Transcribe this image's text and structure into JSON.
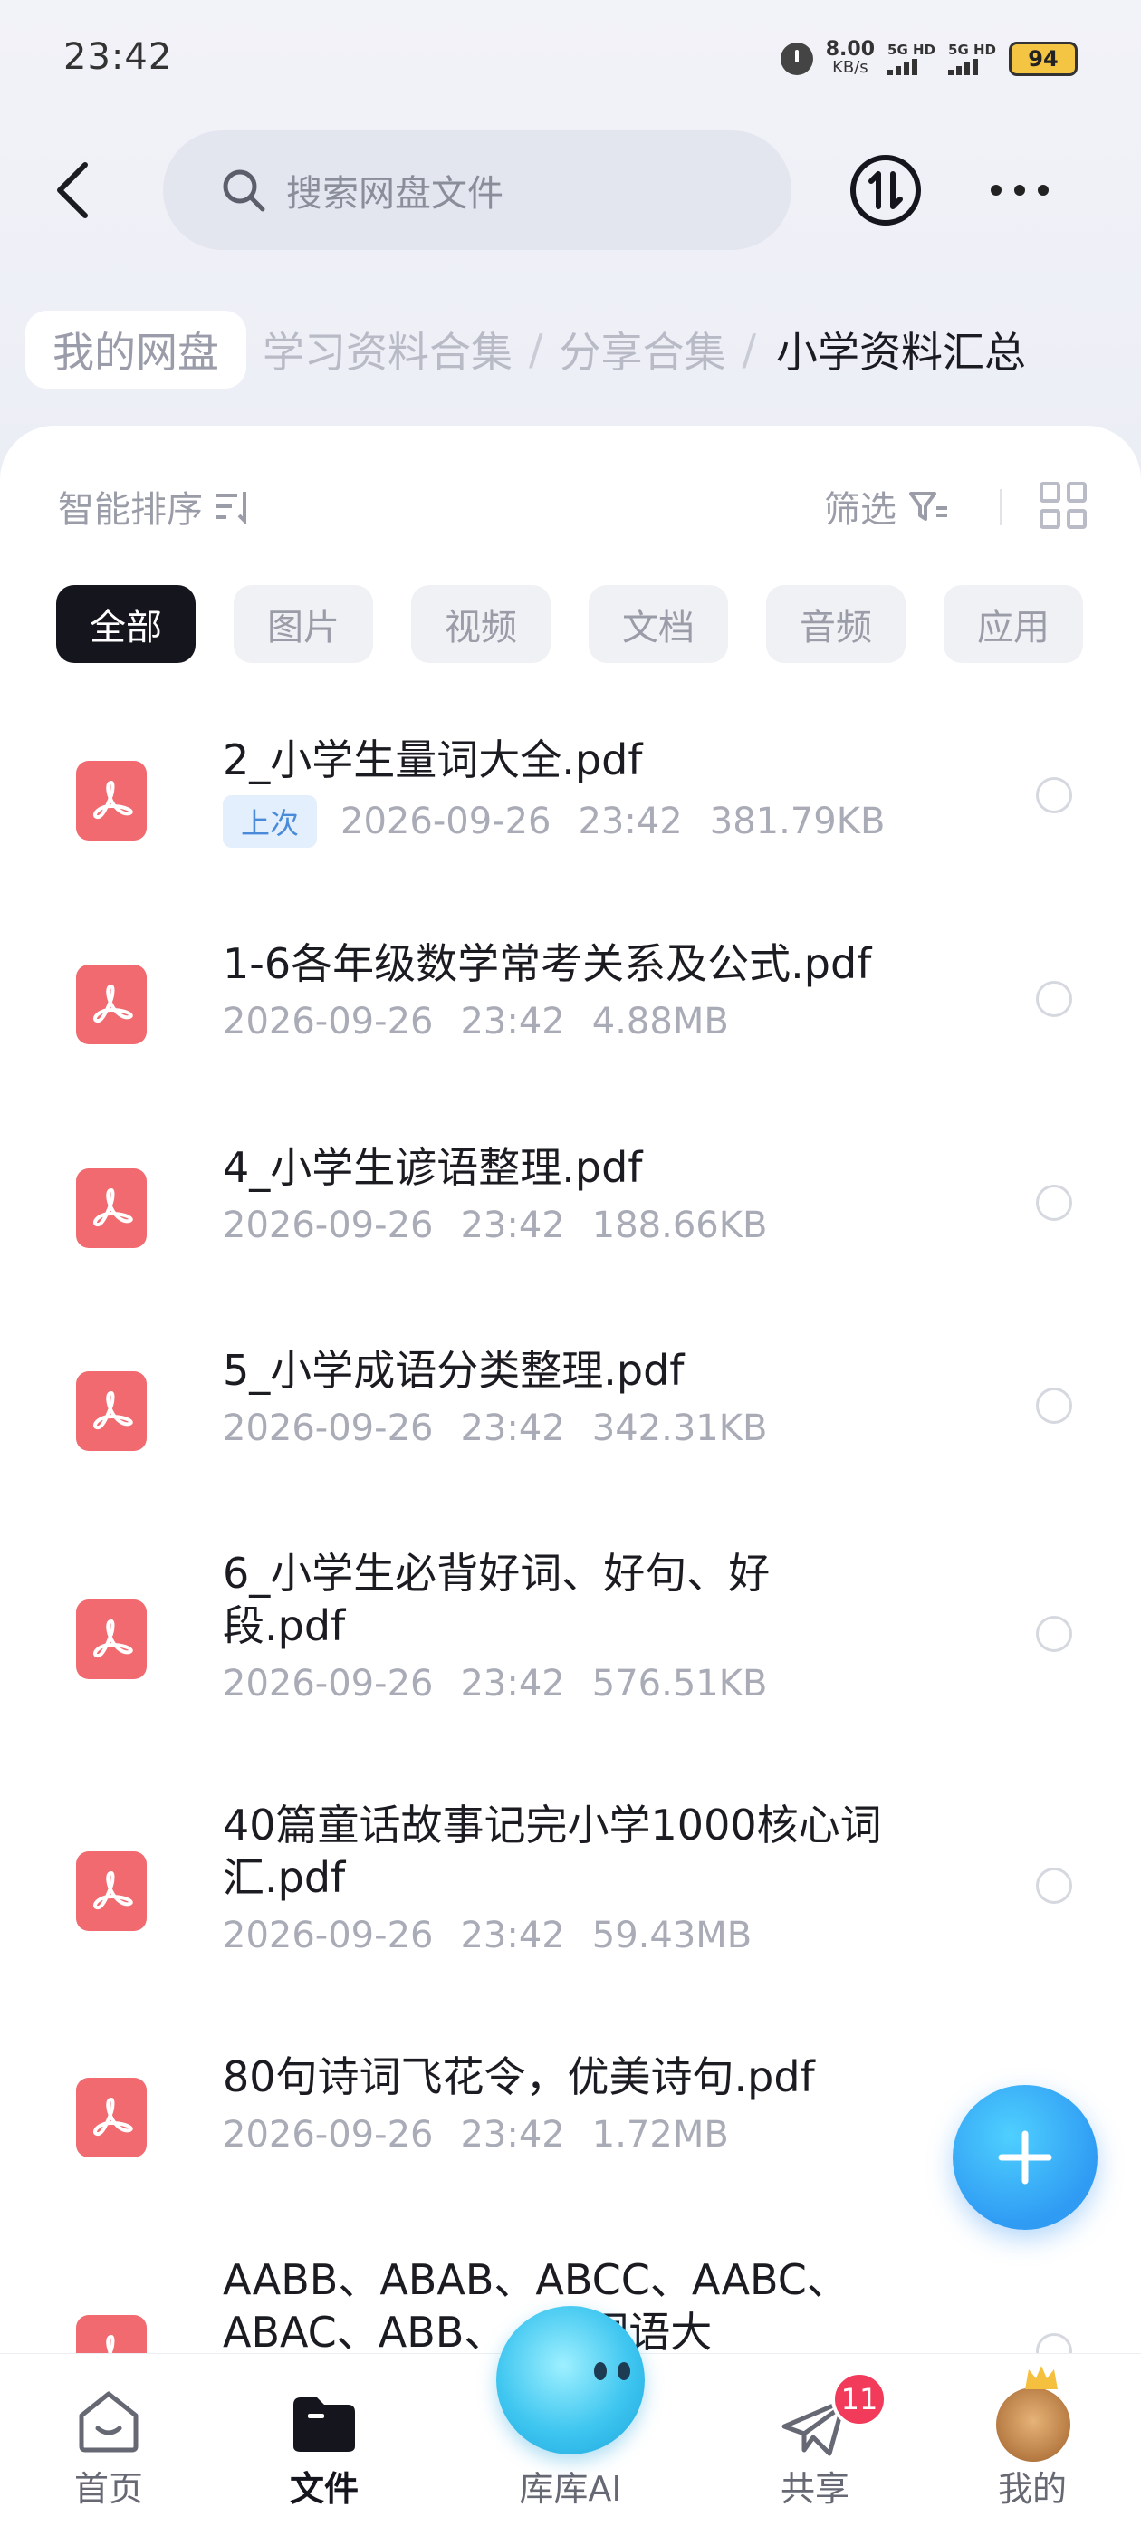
{
  "status_bar": {
    "time": "23:42",
    "net_speed_value": "8.00",
    "net_speed_unit": "KB/s",
    "sim1_label": "5G HD",
    "sim2_label": "5G HD",
    "battery": "94"
  },
  "header": {
    "back_icon": "chevron-left-icon",
    "search_placeholder": "搜索网盘文件",
    "transfer_icon": "transfer-icon",
    "more_icon": "more-icon"
  },
  "breadcrumb": {
    "home": "我的网盘",
    "items": [
      "学习资料合集",
      "分享合集"
    ],
    "current": "小学资料汇总"
  },
  "toolbar": {
    "sort_label": "智能排序",
    "filter_label": "筛选"
  },
  "chips": [
    "全部",
    "图片",
    "视频",
    "文档",
    "音频",
    "应用"
  ],
  "files": [
    {
      "name": "2_小学生量词大全.pdf",
      "tag": "上次",
      "date": "2026-09-26",
      "time": "23:42",
      "size": "381.79KB"
    },
    {
      "name": "1-6各年级数学常考关系及公式.pdf",
      "date": "2026-09-26",
      "time": "23:42",
      "size": "4.88MB"
    },
    {
      "name": "4_小学生谚语整理.pdf",
      "date": "2026-09-26",
      "time": "23:42",
      "size": "188.66KB"
    },
    {
      "name": "5_小学成语分类整理.pdf",
      "date": "2026-09-26",
      "time": "23:42",
      "size": "342.31KB"
    },
    {
      "name": "6_小学生必背好词、好句、好段.pdf",
      "date": "2026-09-26",
      "time": "23:42",
      "size": "576.51KB"
    },
    {
      "name": "40篇童话故事记完小学1000核心词汇.pdf",
      "date": "2026-09-26",
      "time": "23:42",
      "size": "59.43MB"
    },
    {
      "name": "80句诗词飞花令，优美诗句.pdf",
      "date": "2026-09-26",
      "time": "23:42",
      "size": "1.72MB"
    },
    {
      "name": "AABB、ABAB、ABCC、AABC、ABAC、ABB、...式词语大"
    }
  ],
  "bottom_nav": {
    "home": "首页",
    "files": "文件",
    "ai": "库库AI",
    "share": "共享",
    "share_badge": "11",
    "me": "我的"
  },
  "colors": {
    "accent_blue": "#2f9bf3",
    "pdf_red": "#f06a70",
    "badge_red": "#f23a5a",
    "active_chip": "#15151d"
  }
}
